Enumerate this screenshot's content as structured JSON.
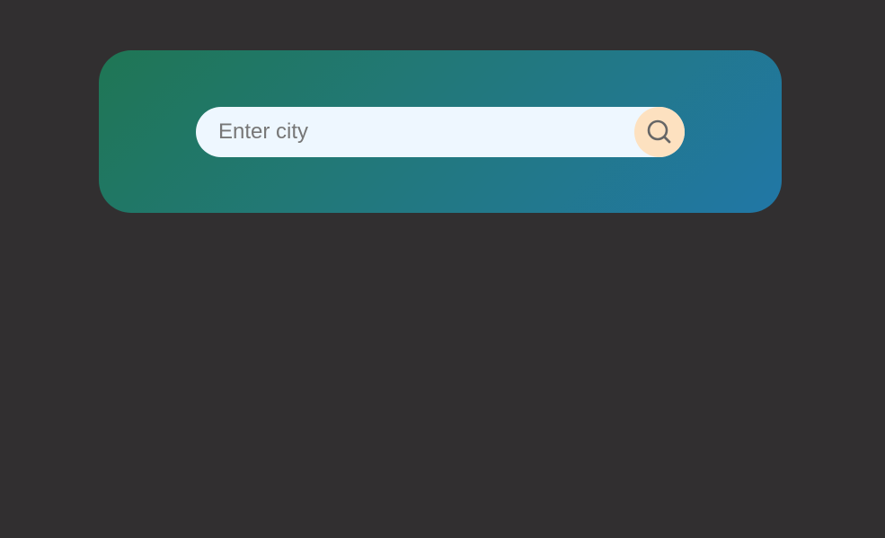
{
  "search": {
    "placeholder": "Enter city",
    "value": "",
    "button_icon": "search-icon"
  },
  "colors": {
    "page_background": "#312f30",
    "card_gradient_start": "#1f7654",
    "card_gradient_end": "#2177a6",
    "input_background": "#eef7ff",
    "button_background": "#fde1c0",
    "icon_color": "#666666"
  }
}
